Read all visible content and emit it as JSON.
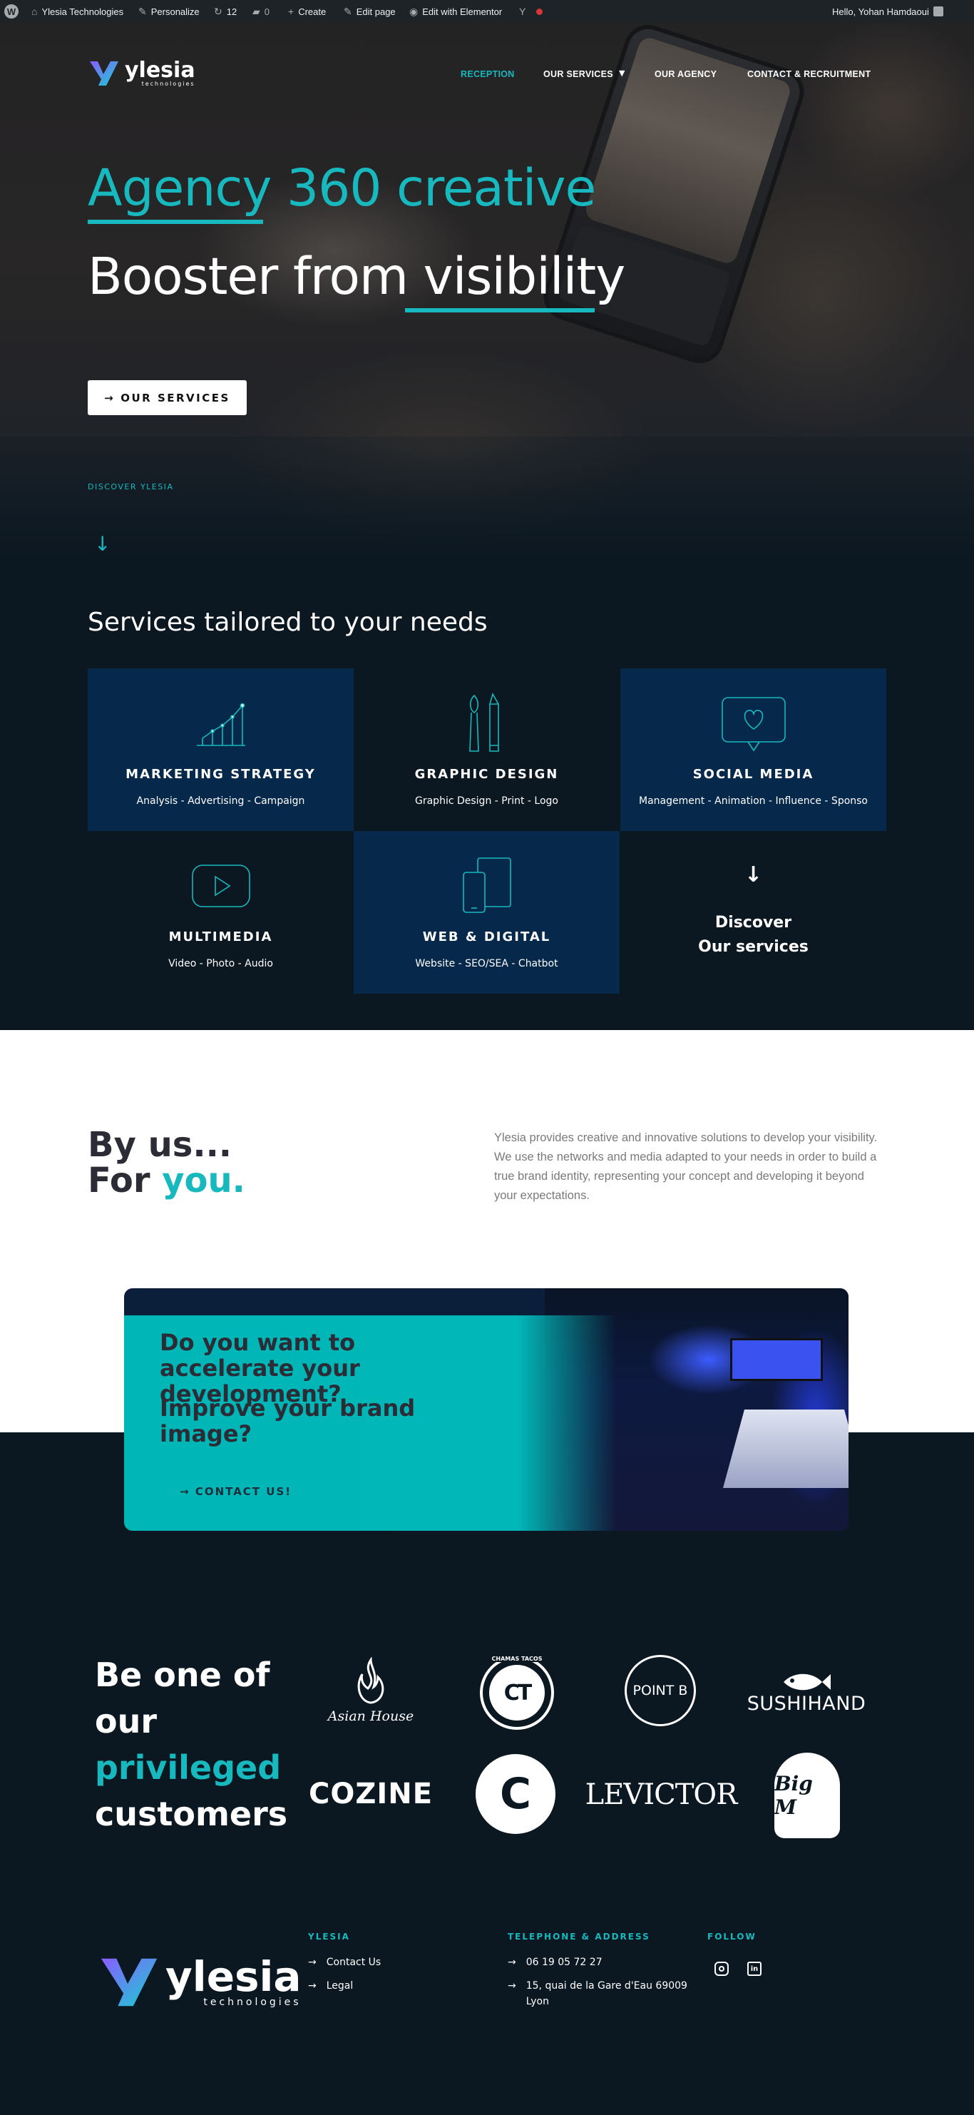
{
  "adminbar": {
    "site_name": "Ylesia Technologies",
    "customize": "Personalize",
    "updates_count": "12",
    "comments_count": "0",
    "create": "Create",
    "edit_page": "Edit page",
    "elementor": "Edit with Elementor",
    "yoast": "Y",
    "greeting": "Hello, Yohan Hamdaoui"
  },
  "logo": {
    "name": "ylesia",
    "tagline": "technologies"
  },
  "nav": {
    "items": [
      "RECEPTION",
      "OUR SERVICES",
      "OUR AGENCY",
      "CONTACT & RECRUITMENT"
    ],
    "active": "RECEPTION"
  },
  "hero": {
    "line1_a": "Agency",
    "line1_b": "360 creative",
    "line2_a": "Booster from",
    "line2_b": "visibility",
    "button": "OUR SERVICES",
    "kicker": "DISCOVER YLESIA"
  },
  "services": {
    "title": "Services tailored to your needs",
    "cards": [
      {
        "title": "MARKETING STRATEGY",
        "subtitle": "Analysis - Advertising - Campaign",
        "icon": "chart-growth-icon"
      },
      {
        "title": "GRAPHIC DESIGN",
        "subtitle": "Graphic Design - Print - Logo",
        "icon": "brush-pencil-icon"
      },
      {
        "title": "SOCIAL MEDIA",
        "subtitle": "Management - Animation - Influence - Sponso",
        "icon": "heart-chat-icon"
      },
      {
        "title": "MULTIMEDIA",
        "subtitle": "Video - Photo - Audio",
        "icon": "play-video-icon"
      },
      {
        "title": "WEB & DIGITAL",
        "subtitle": "Website - SEO/SEA - Chatbot",
        "icon": "devices-icon"
      }
    ],
    "discover": {
      "line1": "Discover",
      "line2": "Our services"
    }
  },
  "intro": {
    "title_line1": "By us...",
    "title_line2_a": "For",
    "title_line2_b": "you.",
    "paragraph": "Ylesia provides creative and innovative solutions to develop your visibility. We use the networks and media adapted to your needs in order to build a true brand identity, representing your concept and developing it beyond your expectations."
  },
  "cta": {
    "heading1": "Do you want to accelerate your development?",
    "heading2": "Improve your brand image?",
    "button": "CONTACT US!"
  },
  "customers": {
    "line1": "Be one of",
    "line2": "our",
    "line3": "privileged",
    "line4": "customers",
    "brands": [
      "Asian House",
      "CHAMAS TACOS",
      "POINT B",
      "SUSHIHAND",
      "COZINE",
      "C",
      "LEVICTOR",
      "Big M"
    ]
  },
  "footer": {
    "col1_title": "YLESIA",
    "col1_links": [
      "Contact Us",
      "Legal"
    ],
    "col2_title": "TELEPHONE & ADDRESS",
    "phone": "06 19 05 72 27",
    "address_line1": "15, quai de la Gare d'Eau 69009",
    "address_line2": "Lyon",
    "col3_title": "FOLLOW",
    "social": [
      "instagram-icon",
      "linkedin-icon"
    ]
  },
  "colors": {
    "accent": "#17b8be",
    "navy": "#05284b",
    "dark": "#0c1821"
  }
}
